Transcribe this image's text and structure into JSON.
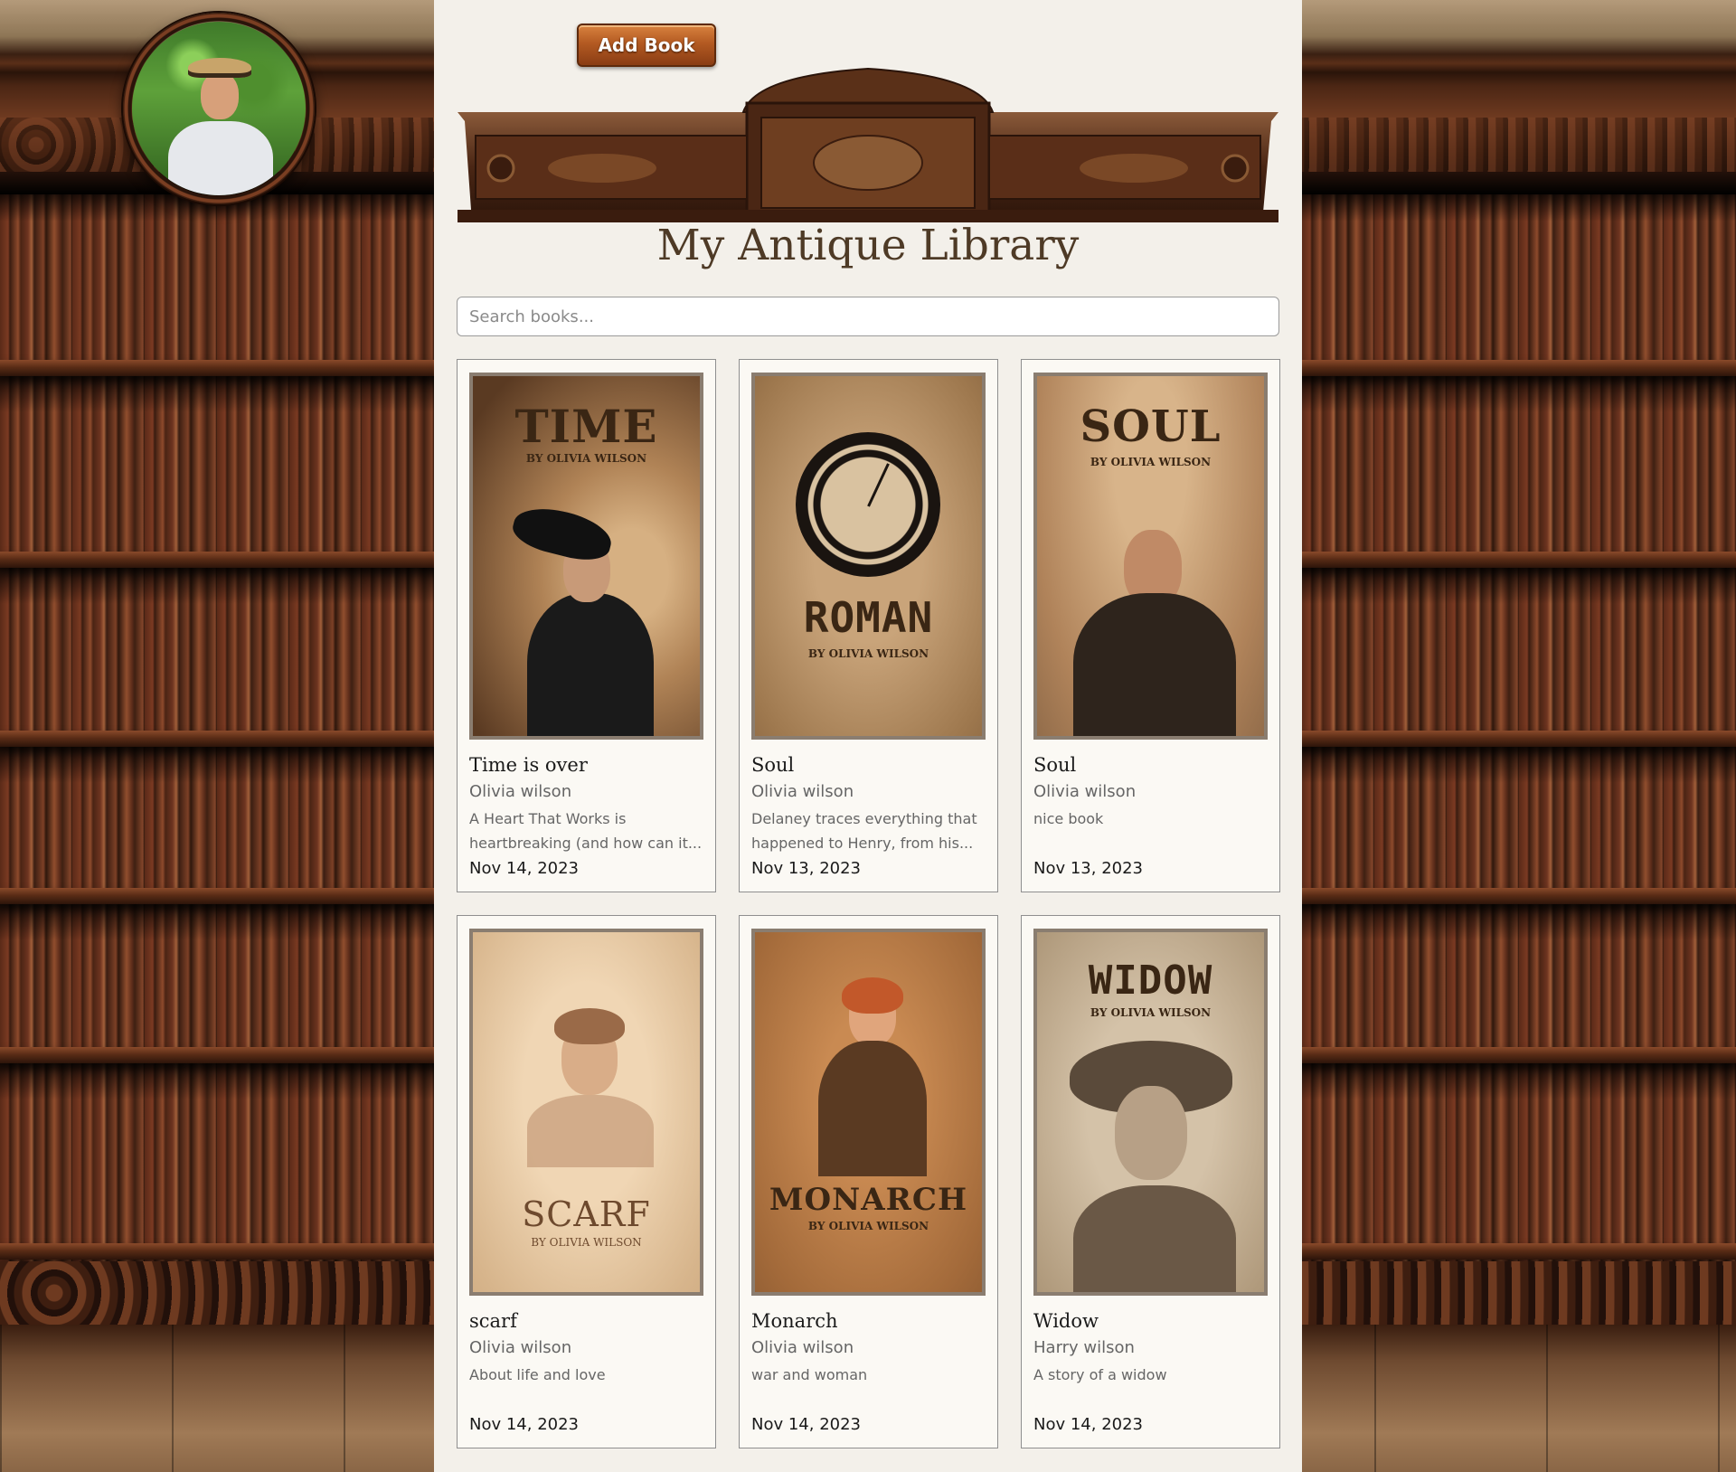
{
  "header": {
    "add_book_label": "Add Book",
    "title": "My Antique Library"
  },
  "search": {
    "placeholder": "Search books...",
    "value": ""
  },
  "colors": {
    "panel_bg": "#f3f0ea",
    "button_orange": "#b35a22",
    "title_brown": "#4e3a26"
  },
  "books": [
    {
      "title": "Time is over",
      "author": "Olivia wilson",
      "description": "A Heart That Works is heartbreaking (and how can it...",
      "date": "Nov 14, 2023",
      "cover_word": "TIME",
      "cover_by": "BY OLIVIA WILSON"
    },
    {
      "title": "Soul",
      "author": "Olivia wilson",
      "description": "Delaney traces everything that happened to Henry, from his...",
      "date": "Nov 13, 2023",
      "cover_word": "ROMAN",
      "cover_by": "BY OLIVIA WILSON"
    },
    {
      "title": "Soul",
      "author": "Olivia wilson",
      "description": "nice book",
      "date": "Nov 13, 2023",
      "cover_word": "SOUL",
      "cover_by": "BY OLIVIA WILSON"
    },
    {
      "title": "scarf",
      "author": "Olivia wilson",
      "description": "About life and love",
      "date": "Nov 14, 2023",
      "cover_word": "SCARF",
      "cover_by": "BY OLIVIA WILSON"
    },
    {
      "title": "Monarch",
      "author": "Olivia wilson",
      "description": "war and woman",
      "date": "Nov 14, 2023",
      "cover_word": "MONARCH",
      "cover_by": "BY OLIVIA WILSON"
    },
    {
      "title": "Widow",
      "author": "Harry wilson",
      "description": "A story of a widow",
      "date": "Nov 14, 2023",
      "cover_word": "WIDOW",
      "cover_by": "BY OLIVIA WILSON"
    }
  ]
}
